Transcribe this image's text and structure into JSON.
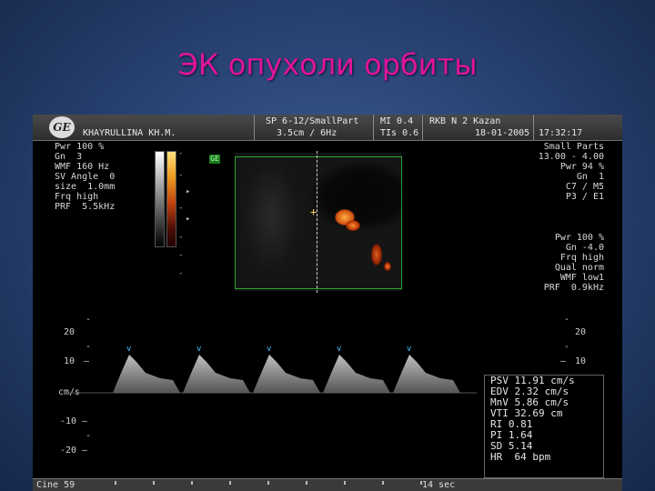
{
  "slide": {
    "title": "ЭК опухоли орбиты"
  },
  "header": {
    "logo": "GE",
    "patient": "KHAYRULLINA KH.M.",
    "probe": "SP 6-12/SmallPart",
    "depth_freq": "3.5cm / 6Hz",
    "mi": "MI 0.4",
    "tis": "TIs 0.6",
    "site": "RKB N 2 Kazan",
    "date": "18-01-2005",
    "time": "17:32:17"
  },
  "left_params": [
    "Pwr 100 %",
    "Gn  3",
    "WMF 160 Hz",
    "SV Angle  0",
    "size  1.0mm",
    "Frq high",
    "PRF  5.5kHz"
  ],
  "right_params_top": [
    "Small Parts",
    "13.00 - 4.00",
    "Pwr 94 %",
    "Gn  1",
    "C7 / M5",
    "P3 / E1"
  ],
  "right_params_bottom": [
    "Pwr 100 %",
    "Gn -4.0",
    "Frq high",
    "Qual norm",
    "WMF low1",
    "PRF  0.9kHz"
  ],
  "image": {
    "badge": "GE"
  },
  "spectral": {
    "left_scale": [
      "20",
      "10",
      "cm/s",
      "-10",
      "-20"
    ],
    "right_scale": [
      "20",
      "10"
    ],
    "peaks": 5
  },
  "measurements": [
    "PSV 11.91 cm/s",
    "EDV 2.32 cm/s",
    "MnV 5.86 cm/s",
    "VTI 32.69 cm",
    "RI 0.81",
    "PI 1.64",
    "SD 5.14",
    "HR  64 bpm"
  ],
  "footer": {
    "cine": "Cine 59",
    "sweep": "14 sec"
  },
  "colors": {
    "title": "#e0149a",
    "roi": "#2fa32f",
    "background": "#2a4475"
  }
}
